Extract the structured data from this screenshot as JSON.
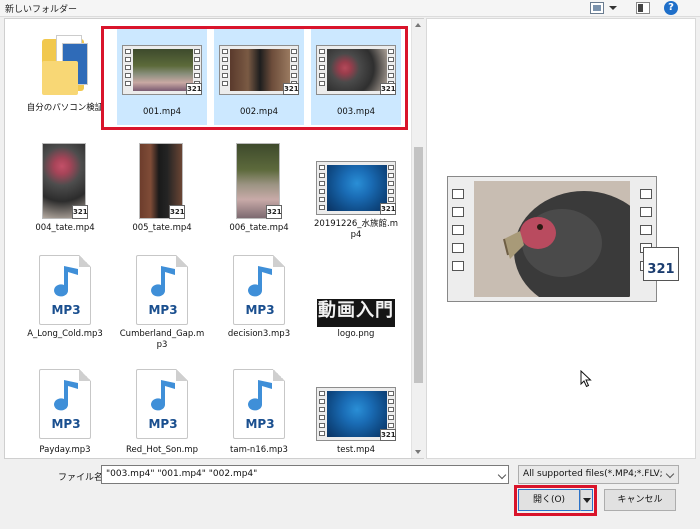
{
  "toolbar": {
    "title": "新しいフォルダー",
    "view_icon": "view-change-icon",
    "pane_icon": "preview-pane-icon",
    "help_icon": "help-icon",
    "help_glyph": "?"
  },
  "files": [
    {
      "name": "自分のパソコン検証",
      "kind": "folder",
      "selected": false
    },
    {
      "name": "001.mp4",
      "kind": "video",
      "selected": true
    },
    {
      "name": "002.mp4",
      "kind": "video",
      "selected": true
    },
    {
      "name": "003.mp4",
      "kind": "video",
      "selected": true
    },
    {
      "name": "004_tate.mp4",
      "kind": "portrait-video",
      "selected": false
    },
    {
      "name": "005_tate.mp4",
      "kind": "portrait-video",
      "selected": false
    },
    {
      "name": "006_tate.mp4",
      "kind": "portrait-video",
      "selected": false
    },
    {
      "name": "20191226_水族館.mp4",
      "kind": "video",
      "selected": false
    },
    {
      "name": "A_Long_Cold.mp3",
      "kind": "audio",
      "selected": false
    },
    {
      "name": "Cumberland_Gap.mp3",
      "kind": "audio",
      "selected": false
    },
    {
      "name": "decision3.mp3",
      "kind": "audio",
      "selected": false
    },
    {
      "name": "logo.png",
      "kind": "image",
      "selected": false
    },
    {
      "name": "Payday.mp3",
      "kind": "audio",
      "selected": false
    },
    {
      "name": "Red_Hot_Son.mp",
      "kind": "audio",
      "selected": false
    },
    {
      "name": "tam-n16.mp3",
      "kind": "audio",
      "selected": false
    },
    {
      "name": "test.mp4",
      "kind": "video",
      "selected": false
    }
  ],
  "thumb_text": {
    "badge": "321",
    "mp3": "MP3",
    "logo": "動画入門"
  },
  "preview": {
    "badge": "321"
  },
  "filename": {
    "label": "ファイル名(N):",
    "value": "\"003.mp4\" \"001.mp4\" \"002.mp4\""
  },
  "filetype": {
    "selected": "All supported files(*.MP4;*.FLV;"
  },
  "buttons": {
    "open": "開く(O)",
    "cancel": "キャンセル"
  },
  "colors": {
    "selection": "#cce8ff",
    "highlight": "#d9142b",
    "accent": "#2b72c9"
  }
}
